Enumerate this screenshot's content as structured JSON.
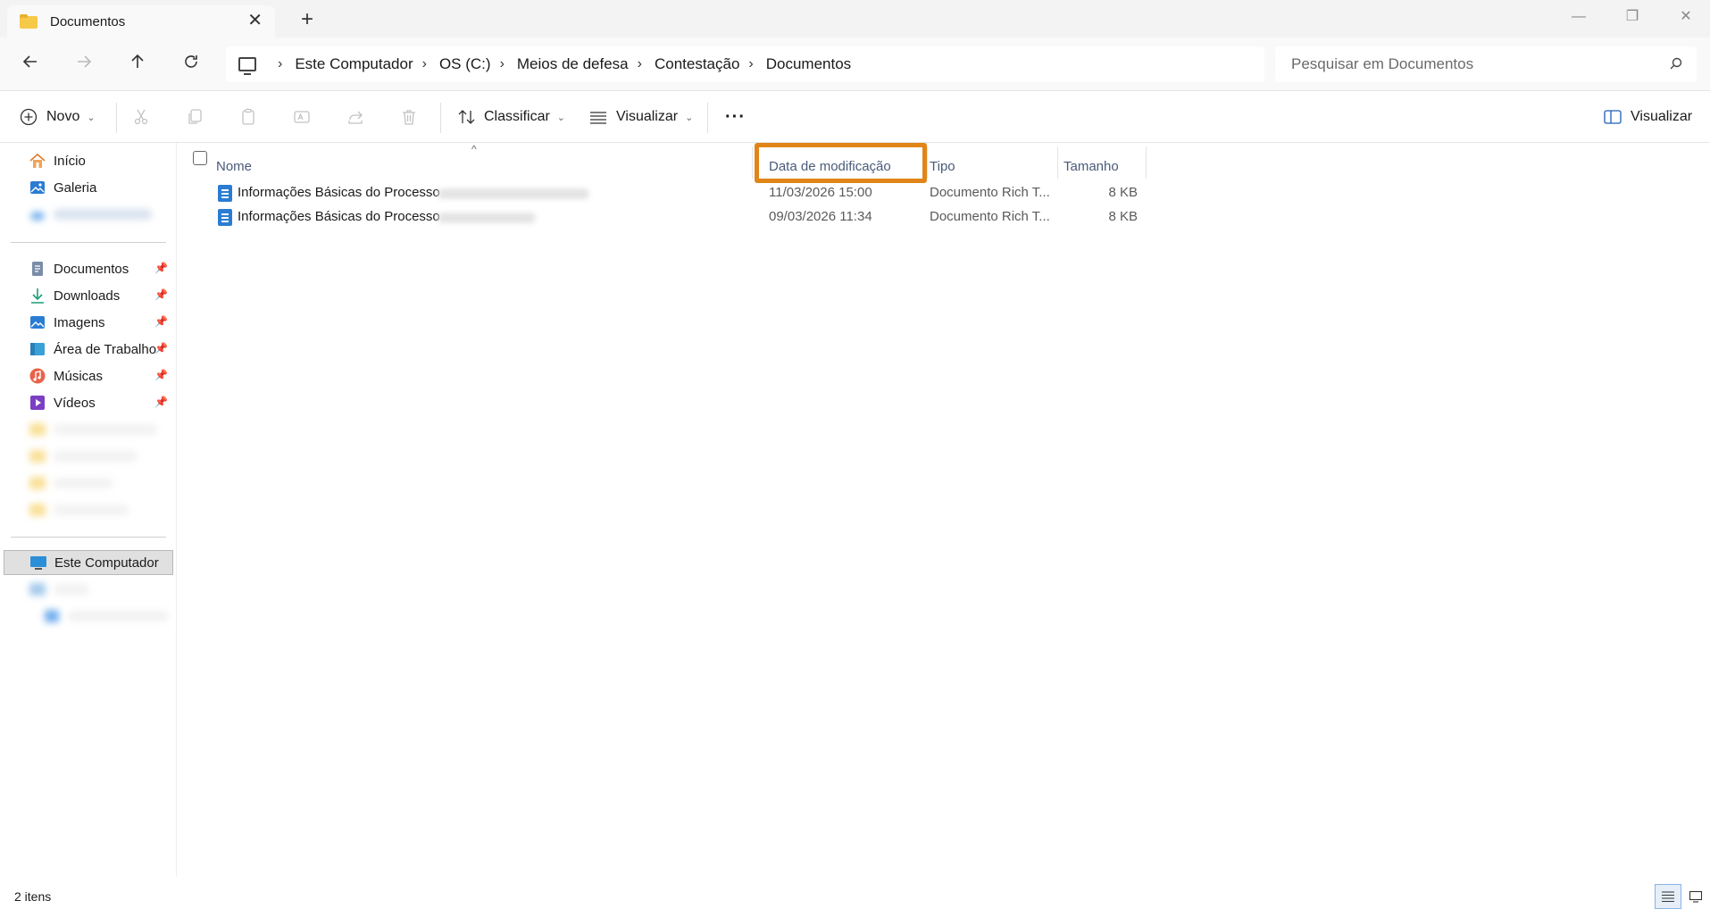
{
  "window": {
    "tab_title": "Documentos",
    "new_tab_label": "+",
    "close_tab_label": "✕",
    "minimize_label": "—",
    "maximize_label": "❐",
    "close_label": "✕"
  },
  "address": {
    "crumbs": [
      "Este Computador",
      "OS (C:)",
      "Meios de defesa",
      "Contestação",
      "Documentos"
    ],
    "search_placeholder": "Pesquisar em Documentos"
  },
  "commands": {
    "new_label": "Novo",
    "sort_label": "Classificar",
    "view_label": "Visualizar",
    "more_label": "···",
    "preview_label": "Visualizar"
  },
  "sidebar": {
    "top": [
      {
        "label": "Início",
        "icon": "home-icon"
      },
      {
        "label": "Galeria",
        "icon": "gallery-icon"
      }
    ],
    "pinned": [
      {
        "label": "Documentos",
        "icon": "documents-icon"
      },
      {
        "label": "Downloads",
        "icon": "downloads-icon"
      },
      {
        "label": "Imagens",
        "icon": "pictures-icon"
      },
      {
        "label": "Área de Trabalho",
        "icon": "desktop-icon"
      },
      {
        "label": "Músicas",
        "icon": "music-icon"
      },
      {
        "label": "Vídeos",
        "icon": "videos-icon"
      }
    ],
    "this_pc": {
      "label": "Este Computador",
      "icon": "computer-icon"
    }
  },
  "columns": {
    "name": "Nome",
    "date": "Data de modificação",
    "type": "Tipo",
    "size": "Tamanho"
  },
  "files": [
    {
      "name": "Informações Básicas do Processo",
      "date": "11/03/2026 15:00",
      "type": "Documento Rich T...",
      "size": "8 KB"
    },
    {
      "name": "Informações Básicas do Processo",
      "date": "09/03/2026 11:34",
      "type": "Documento Rich T...",
      "size": "8 KB"
    }
  ],
  "status": {
    "item_count": "2 itens"
  },
  "colors": {
    "highlight": "#e08519",
    "folder": "#f7c948",
    "doc_icon": "#2b7cd3"
  }
}
